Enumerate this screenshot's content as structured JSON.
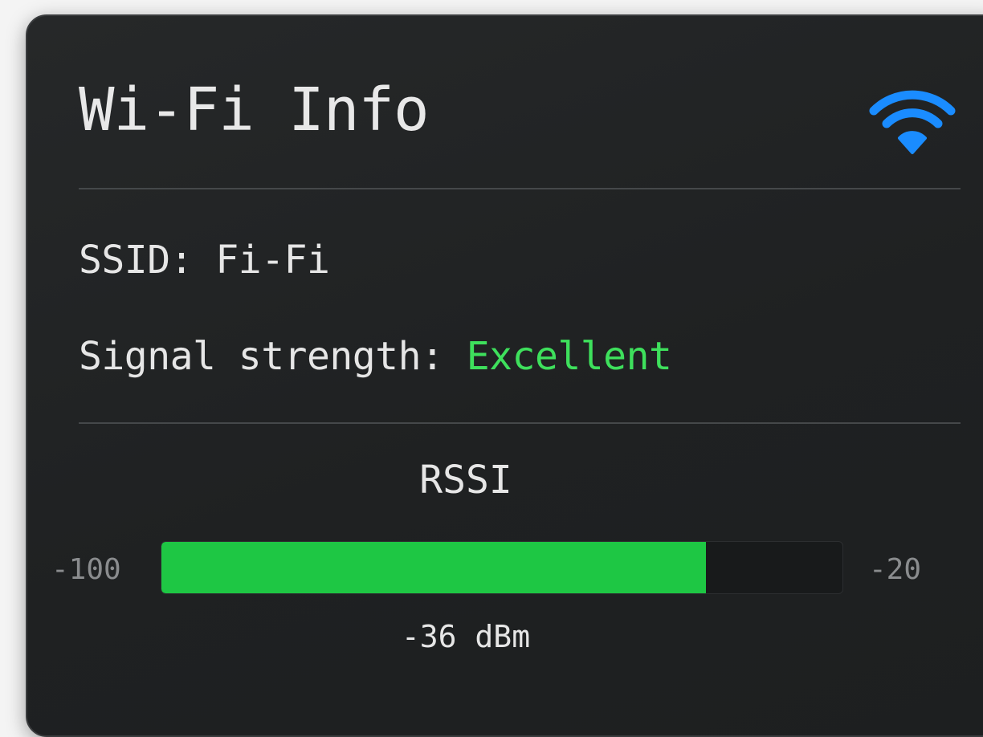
{
  "header": {
    "title": "Wi-Fi Info",
    "icon": "wifi-icon",
    "icon_color": "#1a8cff"
  },
  "info": {
    "ssid_label": "SSID:",
    "ssid_value": "Fi-Fi",
    "signal_label": "Signal strength:",
    "signal_value": "Excellent",
    "signal_color": "#3ee05c"
  },
  "rssi": {
    "label": "RSSI",
    "min_label": "-100",
    "max_label": "-20",
    "min": -100,
    "max": -20,
    "value": -36,
    "reading": "-36 dBm",
    "bar_color": "#1ec744"
  }
}
